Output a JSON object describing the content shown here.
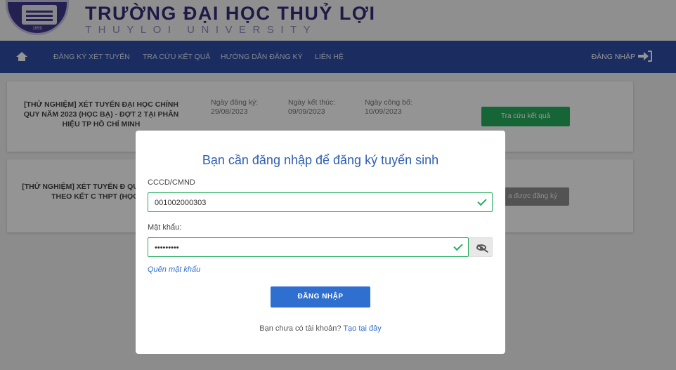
{
  "header": {
    "logo_year": "1959",
    "title": "TRƯỜNG ĐẠI HỌC THUỶ LỢI",
    "subtitle": "THUYLOI UNIVERSITY"
  },
  "nav": {
    "items": [
      "ĐĂNG KÝ XÉT TUYỂN",
      "TRA CỨU KẾT QUẢ",
      "HƯỚNG DẪN ĐĂNG KÝ",
      "LIÊN HỆ"
    ],
    "login_label": "ĐĂNG NHẬP"
  },
  "cards": [
    {
      "title": "[THỬ NGHIỆM] XÉT TUYỂN ĐẠI HỌC CHÍNH QUY NĂM 2023 (HỌC BẠ) - ĐỢT 2 TẠI PHÂN HIỆU TP HỒ CHÍ MINH",
      "reg_label": "Ngày đăng ký:",
      "reg_date": "29/08/2023",
      "end_label": "Ngày kết thúc:",
      "end_date": "09/09/2023",
      "pub_label": "Ngày công bố:",
      "pub_date": "10/09/2023",
      "button": "Tra cứu kết quả"
    },
    {
      "title": "[THỬ NGHIỆM] XÉT TUYỂN Đ QUY NĂM 2024 THEO KẾT C THPT (HỌC BẠ",
      "button": "a được đăng ký"
    }
  ],
  "modal": {
    "title": "Bạn cần đăng nhập để đăng ký tuyển sinh",
    "id_label": "CCCD/CMND",
    "id_value": "001002000303",
    "password_label": "Mật khẩu:",
    "password_value": "•••••••••",
    "forgot": "Quên mật khẩu",
    "submit": "ĐĂNG NHẬP",
    "no_account": "Bạn chưa có tài khoản?",
    "register_link": "Tạo tại đây"
  },
  "colors": {
    "nav": "#2f4fa6",
    "brand": "#332e7d",
    "success": "#27ae60",
    "primary": "#2f6fd0"
  }
}
